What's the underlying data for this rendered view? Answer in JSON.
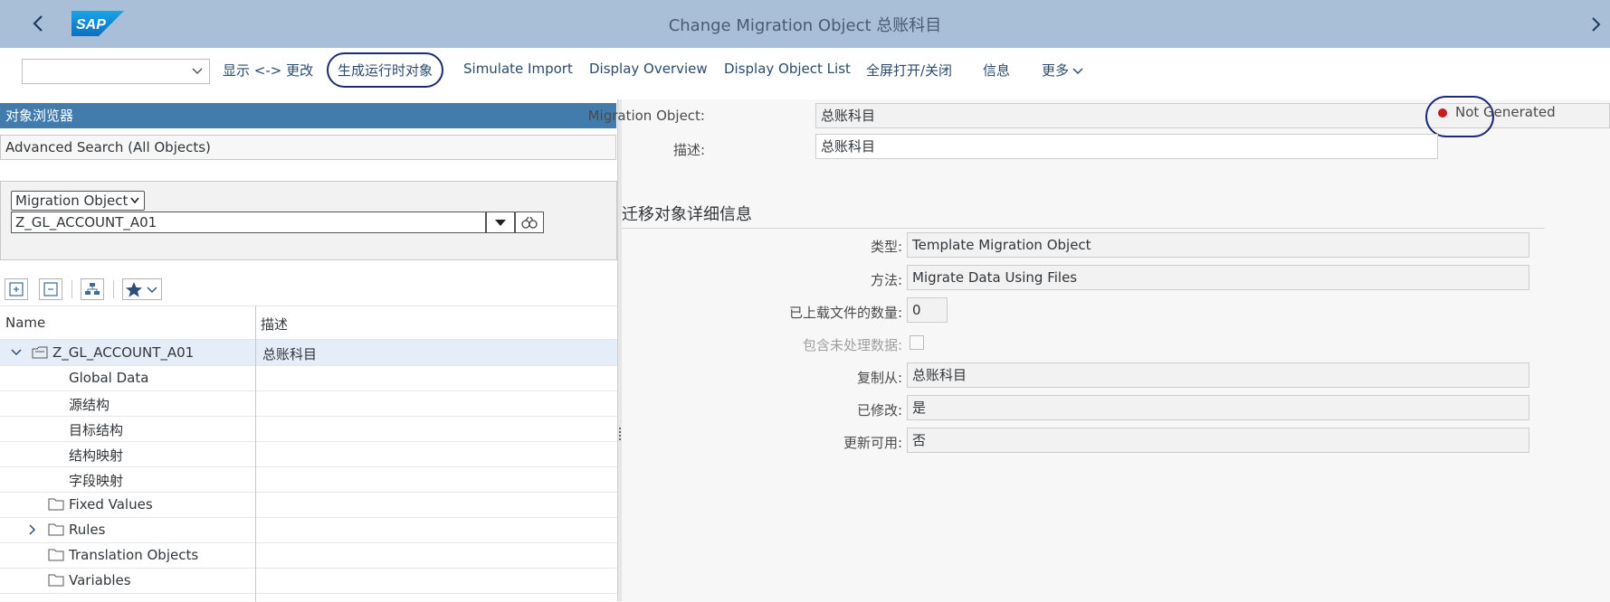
{
  "shell": {
    "title": "Change Migration Object 总账科目",
    "logo_text": "SAP"
  },
  "toolbar": {
    "select_value": "",
    "display_change": "显示 <-> 更改",
    "generate_runtime": "生成运行时对象",
    "simulate_import": "Simulate Import",
    "display_overview": "Display Overview",
    "display_object_list": "Display Object List",
    "fullscreen": "全屏打开/关闭",
    "info": "信息",
    "more": "更多"
  },
  "browser": {
    "header": "对象浏览器",
    "advanced_search": "Advanced Search (All Objects)",
    "object_type": "Migration Object",
    "object_name": "Z_GL_ACCOUNT_A01"
  },
  "tree": {
    "columns": {
      "name": "Name",
      "desc": "描述"
    },
    "root": {
      "name": "Z_GL_ACCOUNT_A01",
      "desc": "总账科目"
    },
    "items": [
      {
        "name": "Global Data"
      },
      {
        "name": "源结构"
      },
      {
        "name": "目标结构"
      },
      {
        "name": "结构映射"
      },
      {
        "name": "字段映射"
      },
      {
        "name": "Fixed Values"
      },
      {
        "name": "Rules"
      },
      {
        "name": "Translation Objects"
      },
      {
        "name": "Variables"
      }
    ]
  },
  "detail": {
    "migration_object_label": "Migration Object:",
    "migration_object_value": "总账科目",
    "status": "Not Generated",
    "status_color": "#cc1919",
    "desc_label": "描述:",
    "desc_value": "总账科目",
    "section_title": "迁移对象详细信息",
    "type_label": "类型:",
    "type_value": "Template Migration Object",
    "method_label": "方法:",
    "method_value": "Migrate Data Using Files",
    "files_label": "已上载文件的数量:",
    "files_value": "0",
    "unprocessed_label": "包含未处理数据:",
    "copied_label": "复制从:",
    "copied_value": "总账科目",
    "modified_label": "已修改:",
    "modified_value": "是",
    "update_label": "更新可用:",
    "update_value": "否"
  }
}
